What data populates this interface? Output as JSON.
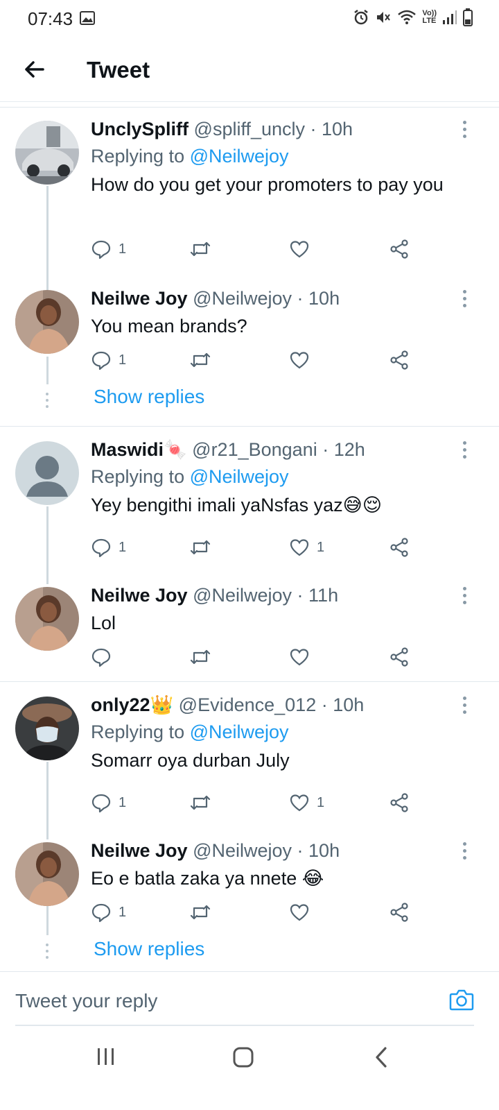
{
  "status_bar": {
    "time": "07:43",
    "icons": [
      "image-icon",
      "alarm-icon",
      "mute-icon",
      "wifi-icon",
      "volte-icon",
      "signal-icon",
      "battery-icon"
    ],
    "volte_label_top": "Vo))",
    "volte_label_bottom": "LTE"
  },
  "header": {
    "title": "Tweet",
    "back_icon": "arrow-left-icon"
  },
  "tweets": [
    {
      "name": "UnclySpliff",
      "handle": "@spliff_uncly",
      "time": "· 10h",
      "replying_prefix": "Replying to",
      "replying_to": "@Neilwejoy",
      "text": "How do you get your promoters  to pay you",
      "reply_count": "1",
      "retweet_count": "",
      "like_count": ""
    },
    {
      "name": "Neilwe Joy",
      "handle": "@Neilwejoy",
      "time": "· 10h",
      "text": "You mean brands?",
      "reply_count": "1",
      "retweet_count": "",
      "like_count": "",
      "show_replies": "Show replies"
    },
    {
      "name": "Maswidi🍬",
      "handle": "@r21_Bongani",
      "time": "· 12h",
      "replying_prefix": "Replying to",
      "replying_to": "@Neilwejoy",
      "text": "Yey bengithi imali yaNsfas yaz😅😌",
      "reply_count": "1",
      "retweet_count": "",
      "like_count": "1"
    },
    {
      "name": "Neilwe Joy",
      "handle": "@Neilwejoy",
      "time": "· 11h",
      "text": "Lol",
      "reply_count": "",
      "retweet_count": "",
      "like_count": ""
    },
    {
      "name": "only22👑",
      "handle": "@Evidence_012",
      "time": "· 10h",
      "replying_prefix": "Replying to",
      "replying_to": "@Neilwejoy",
      "text": "Somarr oya durban July",
      "reply_count": "1",
      "retweet_count": "",
      "like_count": "1"
    },
    {
      "name": "Neilwe Joy",
      "handle": "@Neilwejoy",
      "time": "· 10h",
      "text": "Eo e batla zaka ya nnete 😂",
      "reply_count": "1",
      "retweet_count": "",
      "like_count": "",
      "show_replies": "Show replies"
    }
  ],
  "composer": {
    "placeholder": "Tweet your reply",
    "camera_icon": "camera-icon"
  },
  "nav_bar": {
    "icons": [
      "recents-icon",
      "home-icon",
      "back-icon"
    ]
  },
  "colors": {
    "accent": "#1d9bf0",
    "text": "#0f1419",
    "secondary": "#536471",
    "divider": "#e1e8ed"
  }
}
